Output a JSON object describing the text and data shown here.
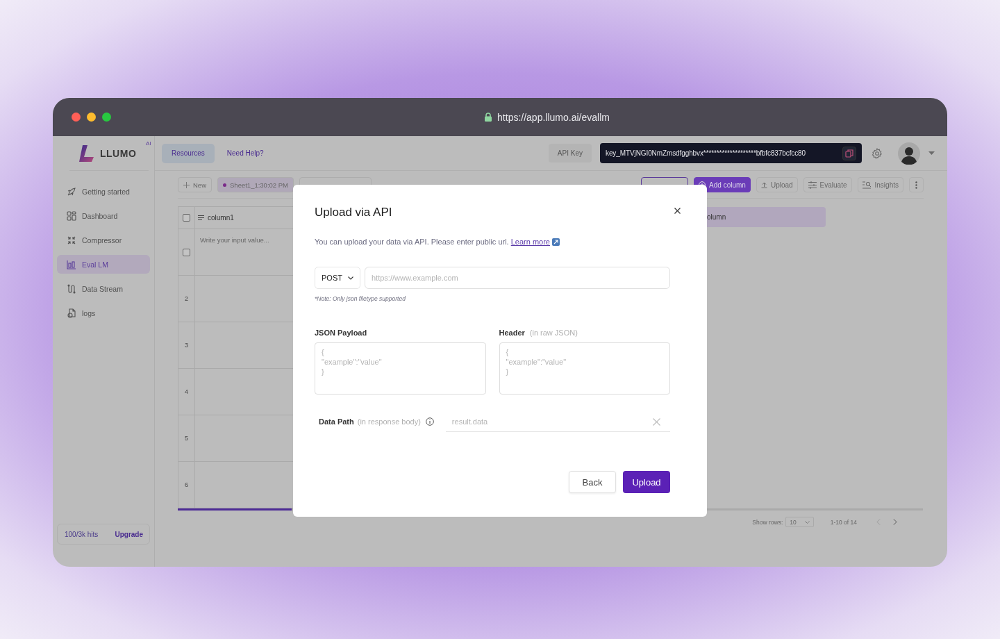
{
  "browser": {
    "url": "https://app.llumo.ai/evallm"
  },
  "logo": {
    "name": "LLUMO",
    "badge": "AI"
  },
  "sidebar": {
    "items": [
      {
        "label": "Getting started",
        "selected": false
      },
      {
        "label": "Dashboard",
        "selected": false
      },
      {
        "label": "Compressor",
        "selected": false
      },
      {
        "label": "Eval LM",
        "selected": true
      },
      {
        "label": "Data Stream",
        "selected": false
      },
      {
        "label": "logs",
        "selected": false
      }
    ],
    "usage": "100/3k hits",
    "upgrade": "Upgrade"
  },
  "header": {
    "links": [
      {
        "label": "Resources",
        "selected": true
      },
      {
        "label": "Need Help?",
        "selected": false
      }
    ],
    "api_key_label": "API Key",
    "api_key": "key_MTVjNGI0NmZmsdfgghbvx********************bfbfc837bcfcc80"
  },
  "toolbar": {
    "new": "New",
    "sheets": [
      {
        "label": "Sheet1_1:30:02 PM",
        "selected": true
      },
      {
        "selected": false
      }
    ],
    "actions": [
      {
        "kind": "outline"
      },
      {
        "label": "Add column",
        "kind": "primary"
      },
      {
        "label": "Upload",
        "kind": "plain"
      },
      {
        "label": "Evaluate",
        "kind": "plain"
      },
      {
        "label": "Insights",
        "kind": "plain"
      }
    ]
  },
  "table": {
    "header_checked": false,
    "columns": [
      "column1",
      "olumn"
    ],
    "rows": [
      {
        "kind": "checkbox",
        "checked": false,
        "placeholder": "Write your input value..."
      },
      {
        "kind": "number",
        "label": "2"
      },
      {
        "kind": "number",
        "label": "3"
      },
      {
        "kind": "number",
        "label": "4"
      },
      {
        "kind": "number",
        "label": "5"
      },
      {
        "kind": "number",
        "label": "6"
      }
    ]
  },
  "pagination": {
    "label": "Show rows:",
    "rows": "10",
    "range": "1-10 of 14"
  },
  "modal": {
    "title": "Upload via API",
    "description": "You can upload your data via API. Please enter public url.",
    "link": "Learn more",
    "method": "POST",
    "url_placeholder": "https://www.example.com",
    "note": "*Note: Only json filetype supported",
    "payload": {
      "label": "JSON Payload",
      "placeholder": "{\n\"example\":\"value\"\n}"
    },
    "header": {
      "label": "Header",
      "hint": "(in raw JSON)",
      "placeholder": "{\n\"example\":\"value\"\n}"
    },
    "data_path": {
      "label": "Data Path",
      "hint": "(in response body)",
      "placeholder": "result.data"
    },
    "buttons": {
      "back": "Back",
      "upload": "Upload"
    }
  }
}
